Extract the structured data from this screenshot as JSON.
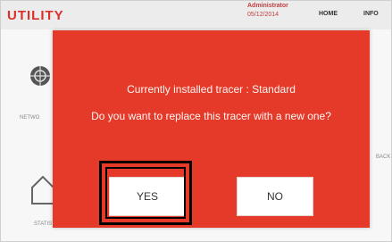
{
  "app": {
    "title": "UTILITY",
    "user": "Administrator",
    "date": "05/12/2014"
  },
  "nav": {
    "home": "HOME",
    "info": "INFO"
  },
  "background_tiles": {
    "network": "NETWO",
    "statistics": "STATISTICS",
    "back": "BACK"
  },
  "dialog": {
    "line1": "Currently installed tracer : Standard",
    "line2": "Do you want to replace this tracer with a new one?",
    "yes_label": "YES",
    "no_label": "NO"
  },
  "colors": {
    "dialog_bg": "#e53a2a",
    "title_red": "#d9302a",
    "button_bg": "#ffffff"
  }
}
